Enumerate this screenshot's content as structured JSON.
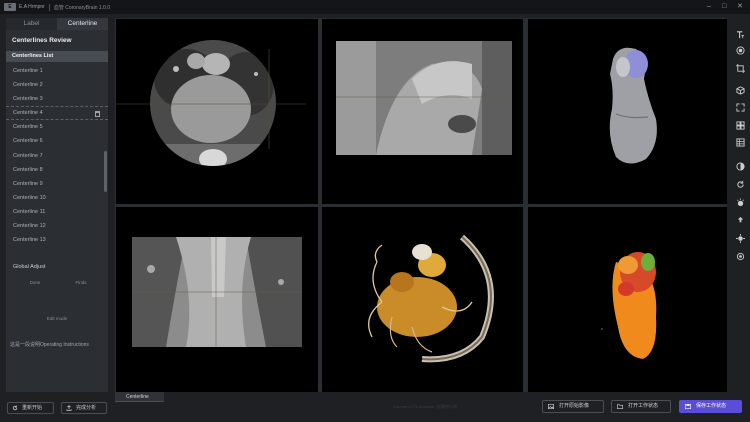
{
  "titlebar": {
    "logo": "E",
    "brand": "E.A Hrmpnr",
    "title": "血管 CoronaryBrain 1.0.0"
  },
  "tabs": [
    {
      "label": "Label",
      "active": false
    },
    {
      "label": "Centerline",
      "active": true
    }
  ],
  "panel": {
    "title": "Centerlines Review",
    "list_title": "Centerlines List",
    "items": [
      {
        "label": "Centerline 1"
      },
      {
        "label": "Centerline 2"
      },
      {
        "label": "Centerline 3"
      },
      {
        "label": "Centerline 4",
        "selected": true
      },
      {
        "label": "Centerline 5"
      },
      {
        "label": "Centerline 6"
      },
      {
        "label": "Centerline 7"
      },
      {
        "label": "Centerline 8"
      },
      {
        "label": "Centerline 9"
      },
      {
        "label": "Centerline 10"
      },
      {
        "label": "Centerline 11"
      },
      {
        "label": "Centerline 12"
      },
      {
        "label": "Centerline 13"
      }
    ],
    "global_adjust": "Global Adjust",
    "ga_buttons": [
      "Done",
      "Finds"
    ],
    "edit_mode": "Edit mode",
    "instructions": "这是一段说明Operating Instructions"
  },
  "bottom_left": {
    "restart": "重新开始",
    "submit": "完成分析"
  },
  "bottom_right": {
    "tab": "Centerline",
    "hint": "Coronary CTA analysis · 血管中心线",
    "open_images": "打开原始影像",
    "open_state": "打开工作状态",
    "save_state": "保存工作状态"
  },
  "colors": {
    "primary": "#5b4ed6",
    "panel_bg": "#2b2e33",
    "app_bg": "#1e2023"
  },
  "icons": [
    "text-tool-icon",
    "record-icon",
    "crop-icon",
    "cube-icon",
    "fullscreen-icon",
    "layout-icon",
    "grid-icon",
    "contrast-icon",
    "rotate-icon",
    "brightness-icon",
    "move-icon",
    "crosshair-icon",
    "target-icon"
  ]
}
